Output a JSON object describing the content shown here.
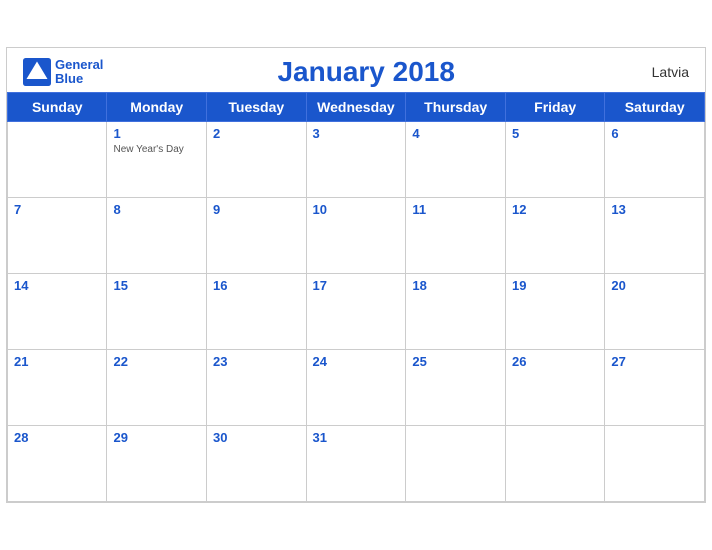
{
  "header": {
    "title": "January 2018",
    "country": "Latvia",
    "logo_line1": "General",
    "logo_line2": "Blue"
  },
  "weekdays": [
    "Sunday",
    "Monday",
    "Tuesday",
    "Wednesday",
    "Thursday",
    "Friday",
    "Saturday"
  ],
  "weeks": [
    [
      {
        "day": "",
        "empty": true
      },
      {
        "day": "1",
        "holiday": "New Year's Day"
      },
      {
        "day": "2"
      },
      {
        "day": "3"
      },
      {
        "day": "4"
      },
      {
        "day": "5"
      },
      {
        "day": "6"
      }
    ],
    [
      {
        "day": "7"
      },
      {
        "day": "8"
      },
      {
        "day": "9"
      },
      {
        "day": "10"
      },
      {
        "day": "11"
      },
      {
        "day": "12"
      },
      {
        "day": "13"
      }
    ],
    [
      {
        "day": "14"
      },
      {
        "day": "15"
      },
      {
        "day": "16"
      },
      {
        "day": "17"
      },
      {
        "day": "18"
      },
      {
        "day": "19"
      },
      {
        "day": "20"
      }
    ],
    [
      {
        "day": "21"
      },
      {
        "day": "22"
      },
      {
        "day": "23"
      },
      {
        "day": "24"
      },
      {
        "day": "25"
      },
      {
        "day": "26"
      },
      {
        "day": "27"
      }
    ],
    [
      {
        "day": "28"
      },
      {
        "day": "29"
      },
      {
        "day": "30"
      },
      {
        "day": "31"
      },
      {
        "day": ""
      },
      {
        "day": ""
      },
      {
        "day": ""
      }
    ]
  ],
  "colors": {
    "header_bg": "#1a56cc",
    "accent": "#1a56cc"
  }
}
